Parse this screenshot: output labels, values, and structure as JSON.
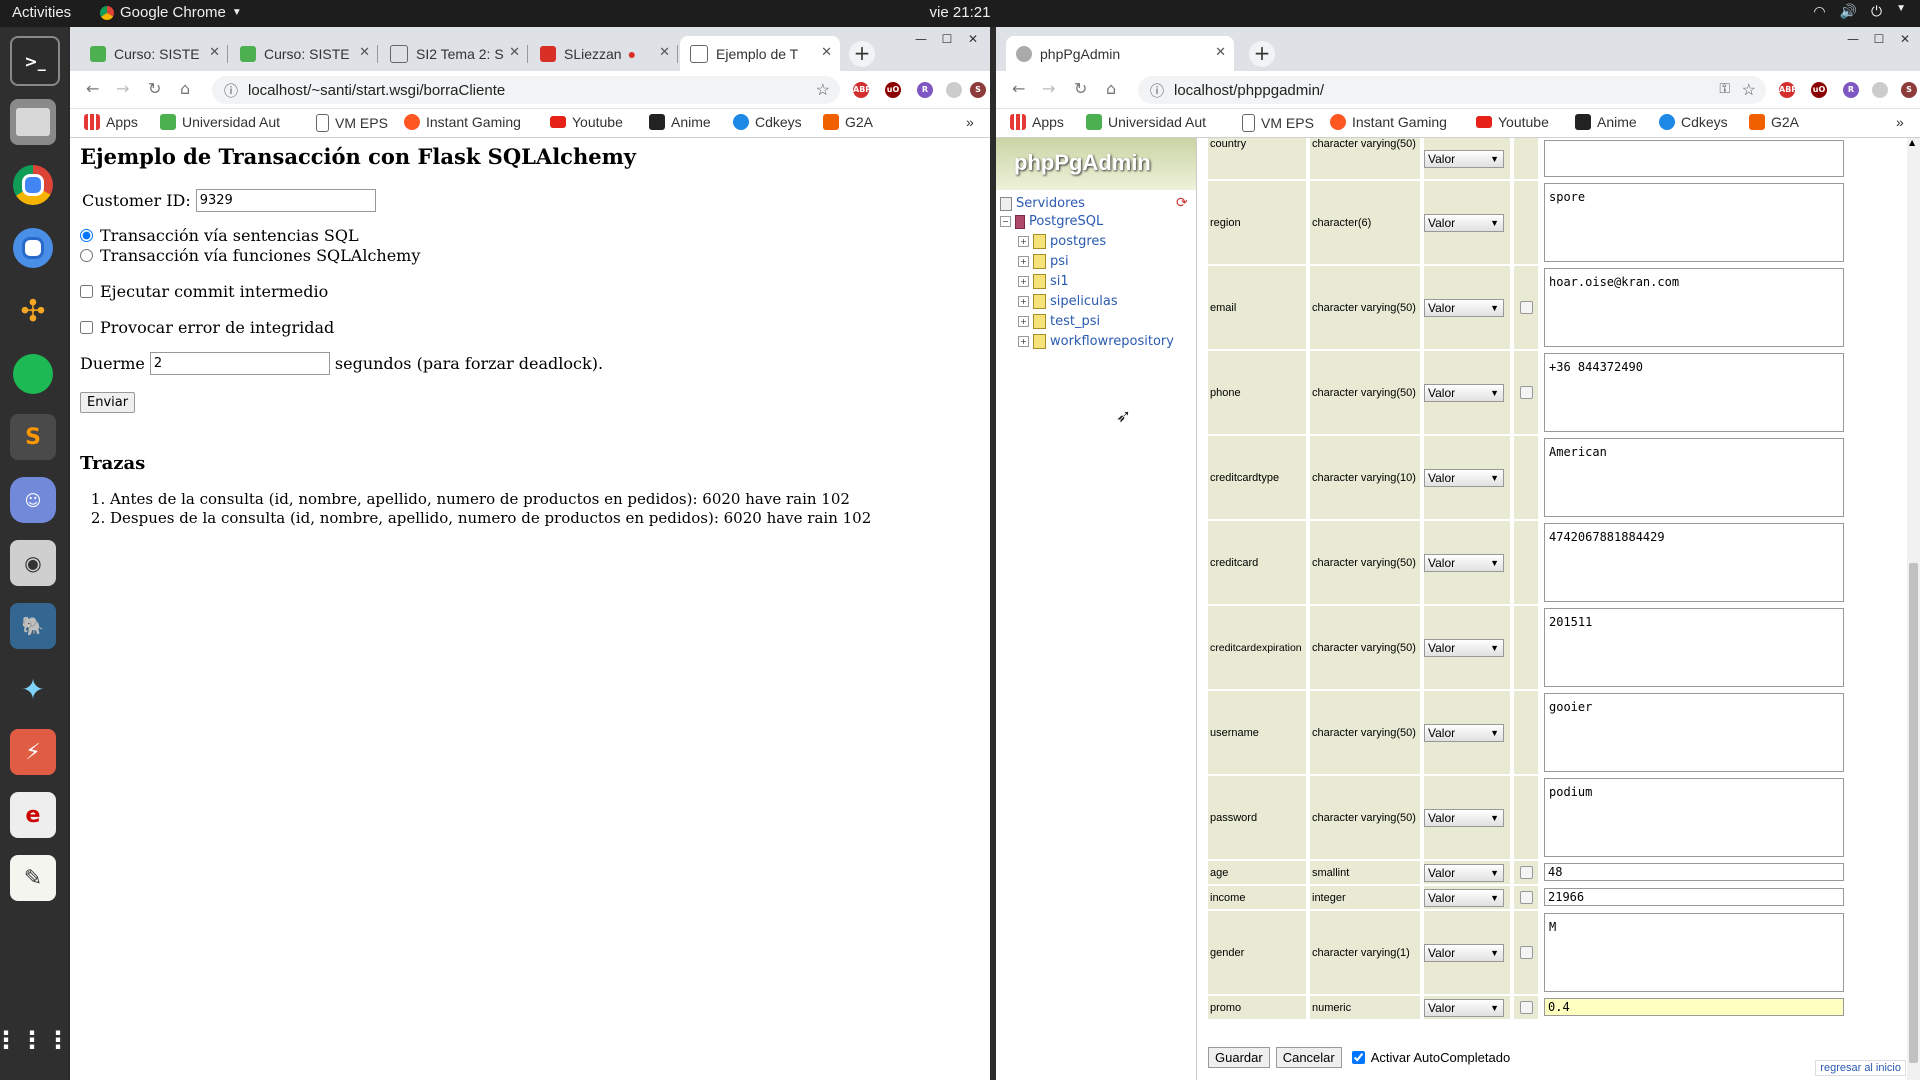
{
  "topbar": {
    "activities": "Activities",
    "app_name": "Google Chrome",
    "clock": "vie 21:21"
  },
  "left_browser": {
    "tabs": [
      {
        "label": "Curso: SISTE"
      },
      {
        "label": "Curso: SISTE"
      },
      {
        "label": "SI2 Tema 2: S"
      },
      {
        "label": "SLiezzan"
      },
      {
        "label": "Ejemplo de T"
      }
    ],
    "url": "localhost/~santi/start.wsgi/borraCliente",
    "bookmarks": [
      "Apps",
      "Universidad Aut",
      "VM EPS",
      "Instant Gaming",
      "Youtube",
      "Anime",
      "Cdkeys",
      "G2A"
    ],
    "ext_badges": [
      "ABP",
      "uO",
      "R",
      "",
      "S"
    ],
    "page": {
      "title": "Ejemplo de Transacción con Flask SQLAlchemy",
      "customer_label": "Customer ID:",
      "customer_value": "9329",
      "radio_sql": "Transacción vía sentencias SQL",
      "radio_alchemy": "Transacción vía funciones SQLAlchemy",
      "commit_label": "Ejecutar commit intermedio",
      "error_label": "Provocar error de integridad",
      "sleep_label": "Duerme",
      "sleep_value": "2",
      "sleep_suffix": "segundos (para forzar deadlock).",
      "submit": "Enviar",
      "traces_title": "Trazas",
      "traces": [
        "Antes de la consulta (id, nombre, apellido, numero de productos en pedidos): 6020 have rain 102",
        "Despues de la consulta (id, nombre, apellido, numero de productos en pedidos): 6020 have rain 102"
      ]
    }
  },
  "right_browser": {
    "tab_label": "phpPgAdmin",
    "url": "localhost/phppgadmin/",
    "bookmarks": [
      "Apps",
      "Universidad Aut",
      "VM EPS",
      "Instant Gaming",
      "Youtube",
      "Anime",
      "Cdkeys",
      "G2A"
    ],
    "logo": "phpPgAdmin",
    "tree": {
      "servers": "Servidores",
      "server": "PostgreSQL",
      "databases": [
        "postgres",
        "psi",
        "si1",
        "sipeliculas",
        "test_psi",
        "workflowrepository"
      ]
    },
    "select_label": "Valor",
    "fields": [
      {
        "name": "country",
        "type": "character varying(50)",
        "value": ""
      },
      {
        "name": "region",
        "type": "character(6)",
        "value": "spore"
      },
      {
        "name": "email",
        "type": "character varying(50)",
        "value": "hoar.oise@kran.com"
      },
      {
        "name": "phone",
        "type": "character varying(50)",
        "value": "+36 844372490"
      },
      {
        "name": "creditcardtype",
        "type": "character varying(10)",
        "value": "American"
      },
      {
        "name": "creditcard",
        "type": "character varying(50)",
        "value": "4742067881884429"
      },
      {
        "name": "creditcardexpiration",
        "type": "character varying(50)",
        "value": "201511"
      },
      {
        "name": "username",
        "type": "character varying(50)",
        "value": "gooier"
      },
      {
        "name": "password",
        "type": "character varying(50)",
        "value": "podium"
      },
      {
        "name": "age",
        "type": "smallint",
        "value": "48"
      },
      {
        "name": "income",
        "type": "integer",
        "value": "21966"
      },
      {
        "name": "gender",
        "type": "character varying(1)",
        "value": "M"
      },
      {
        "name": "promo",
        "type": "numeric",
        "value": "0.4"
      }
    ],
    "save": "Guardar",
    "cancel": "Cancelar",
    "autocomplete": "Activar AutoCompletado",
    "back_top": "regresar al inicio"
  },
  "colors": {
    "row_bg": "#e8ead3",
    "link": "#2a5ab0",
    "highlight_input": "#ffffc0"
  }
}
